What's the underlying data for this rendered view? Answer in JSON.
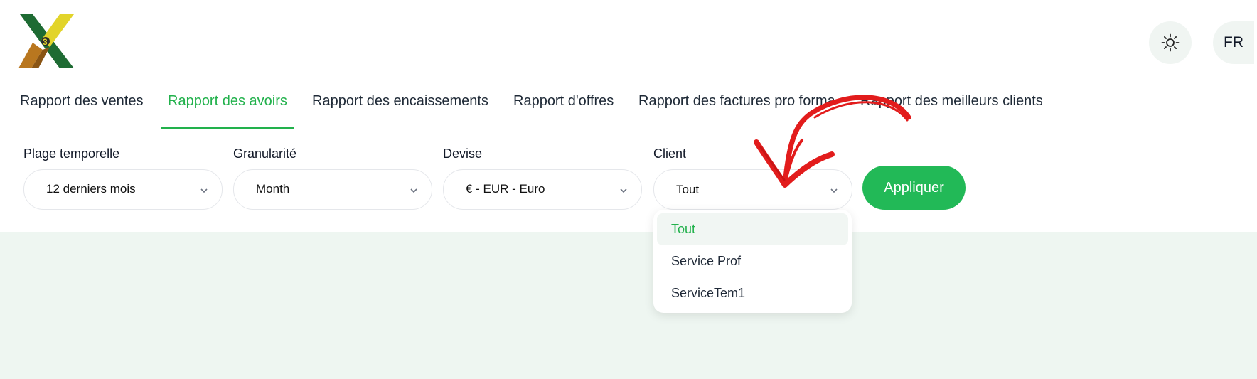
{
  "header": {
    "logo_icon": "x-logo-icon",
    "theme_icon": "sun-icon",
    "language": "FR"
  },
  "tabs": [
    {
      "label": "Rapport des ventes",
      "active": false
    },
    {
      "label": "Rapport des avoirs",
      "active": true
    },
    {
      "label": "Rapport des encaissements",
      "active": false
    },
    {
      "label": "Rapport d'offres",
      "active": false
    },
    {
      "label": "Rapport des factures pro forma",
      "active": false
    },
    {
      "label": "Rapport des meilleurs clients",
      "active": false
    }
  ],
  "filters": {
    "period": {
      "label": "Plage temporelle",
      "value": "12 derniers mois"
    },
    "granularity": {
      "label": "Granularité",
      "value": "Month"
    },
    "currency": {
      "label": "Devise",
      "value": "€ - EUR - Euro"
    },
    "client": {
      "label": "Client",
      "value": "Tout"
    },
    "apply_label": "Appliquer"
  },
  "client_dropdown": {
    "options": [
      "Tout",
      "Service Prof",
      "ServiceTem1"
    ],
    "selected": "Tout"
  },
  "colors": {
    "accent": "#22b14c",
    "button": "#22b957",
    "annotation": "#e21c1c",
    "content_bg": "#eef6f1"
  }
}
